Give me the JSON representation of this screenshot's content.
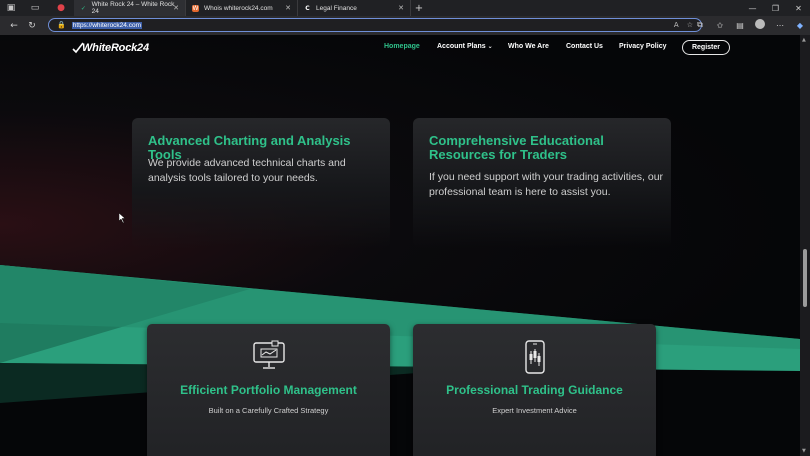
{
  "browser": {
    "tabs": [
      {
        "label": "White Rock 24 – White Rock 24",
        "active": true
      },
      {
        "label": "Whois whiterock24.com",
        "active": false
      },
      {
        "label": "Legal Finance",
        "active": false
      }
    ],
    "new_tab": "+",
    "url": "https://whiterock24.com"
  },
  "site": {
    "logo": "WhiteRock24",
    "nav": {
      "home": "Homepage",
      "plans": "Account Plans",
      "who": "Who We Are",
      "contact": "Contact Us",
      "privacy": "Privacy Policy",
      "register": "Register"
    },
    "features_top": [
      {
        "title": "Advanced Charting and Analysis Tools",
        "text": "We provide advanced technical charts and analysis tools tailored to your needs."
      },
      {
        "title": "Comprehensive Educational Resources for Traders",
        "text": "If you need support with your trading activities, our professional team is here to assist you."
      }
    ],
    "features_bottom": [
      {
        "title": "Efficient Portfolio Management",
        "subtitle": "Built on a Carefully Crafted Strategy",
        "icon": "monitor-chart-icon"
      },
      {
        "title": "Professional Trading Guidance",
        "subtitle": "Expert Investment Advice",
        "icon": "mobile-candlestick-icon"
      }
    ],
    "accent_color": "#2fc18a"
  }
}
